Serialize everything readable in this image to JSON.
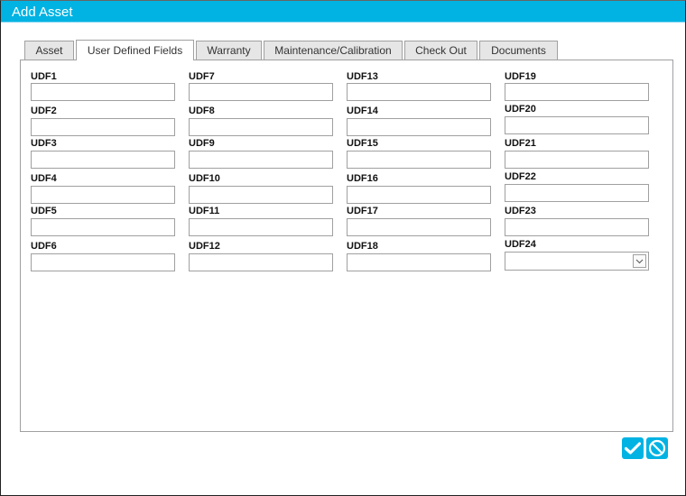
{
  "dialog": {
    "title": "Add Asset"
  },
  "tabs": [
    {
      "label": "Asset",
      "active": false
    },
    {
      "label": "User Defined Fields",
      "active": true
    },
    {
      "label": "Warranty",
      "active": false
    },
    {
      "label": "Maintenance/Calibration",
      "active": false
    },
    {
      "label": "Check Out",
      "active": false
    },
    {
      "label": "Documents",
      "active": false
    }
  ],
  "fields": {
    "col1": [
      {
        "label": "UDF1",
        "value": ""
      },
      {
        "label": "UDF2",
        "value": ""
      },
      {
        "label": "UDF3",
        "value": ""
      },
      {
        "label": "UDF4",
        "value": ""
      },
      {
        "label": "UDF5",
        "value": ""
      },
      {
        "label": "UDF6",
        "value": ""
      }
    ],
    "col2": [
      {
        "label": "UDF7",
        "value": ""
      },
      {
        "label": "UDF8",
        "value": ""
      },
      {
        "label": "UDF9",
        "value": ""
      },
      {
        "label": "UDF10",
        "value": ""
      },
      {
        "label": "UDF11",
        "value": ""
      },
      {
        "label": "UDF12",
        "value": ""
      }
    ],
    "col3": [
      {
        "label": "UDF13",
        "value": ""
      },
      {
        "label": "UDF14",
        "value": ""
      },
      {
        "label": "UDF15",
        "value": ""
      },
      {
        "label": "UDF16",
        "value": ""
      },
      {
        "label": "UDF17",
        "value": ""
      },
      {
        "label": "UDF18",
        "value": ""
      }
    ],
    "col4": [
      {
        "label": "UDF19",
        "value": ""
      },
      {
        "label": "UDF20",
        "value": ""
      },
      {
        "label": "UDF21",
        "value": ""
      },
      {
        "label": "UDF22",
        "value": ""
      },
      {
        "label": "UDF23",
        "value": ""
      },
      {
        "label": "UDF24",
        "value": "",
        "type": "select"
      }
    ]
  },
  "actions": {
    "save": {
      "icon": "checkmark-icon"
    },
    "cancel": {
      "icon": "cancel-icon"
    }
  },
  "colors": {
    "accent": "#00b3e3"
  }
}
